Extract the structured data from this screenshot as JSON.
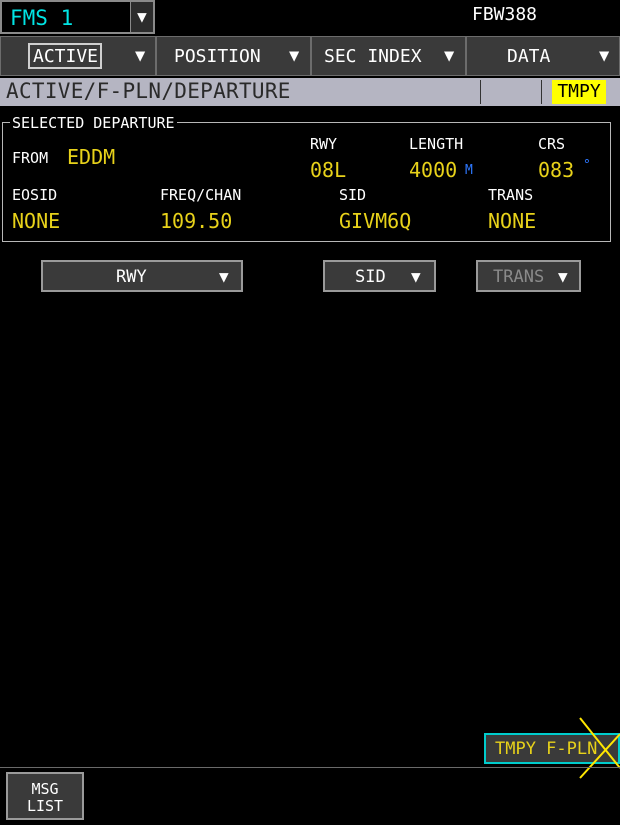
{
  "header": {
    "fms_label": "FMS 1",
    "flight_id": "FBW388"
  },
  "menu": [
    {
      "label": "ACTIVE"
    },
    {
      "label": "POSITION"
    },
    {
      "label": "SEC INDEX"
    },
    {
      "label": "DATA"
    }
  ],
  "title_bar": {
    "path": "ACTIVE/F-PLN/DEPARTURE",
    "tmpy_badge": "TMPY"
  },
  "selected_departure": {
    "legend": "SELECTED DEPARTURE",
    "from_label": "FROM",
    "from_value": "EDDM",
    "rwy_label": "RWY",
    "rwy_value": "08L",
    "length_label": "LENGTH",
    "length_value": "4000",
    "length_unit": "M",
    "crs_label": "CRS",
    "crs_value": "083",
    "crs_unit": "°",
    "eosid_label": "EOSID",
    "eosid_value": "NONE",
    "freq_label": "FREQ/CHAN",
    "freq_value": "109.50",
    "sid_label": "SID",
    "sid_value": "GIVM6Q",
    "trans_label": "TRANS",
    "trans_value": "NONE"
  },
  "dropdowns": {
    "rwy": "RWY",
    "sid": "SID",
    "trans": "TRANS"
  },
  "tmpy_fpln_button": "TMPY F-PLN",
  "msg_list": {
    "line1": "MSG",
    "line2": "LIST"
  },
  "arrow_glyph": "▼",
  "colors": {
    "cyan": "#00e5e5",
    "amber": "#e8d21a",
    "yellow_badge": "#ffff00",
    "unit_blue": "#2e78ff",
    "title_bar": "#b5b5c2"
  }
}
